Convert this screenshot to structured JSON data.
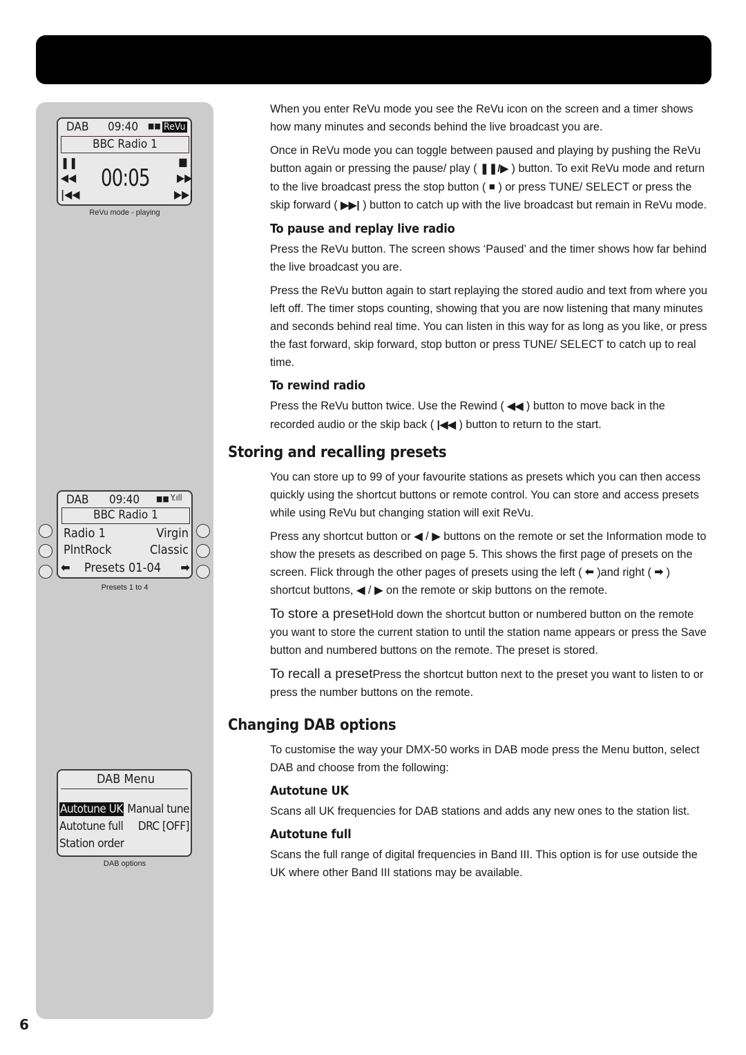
{
  "page": {
    "number": "6"
  },
  "screens": {
    "revu": {
      "mode": "DAB",
      "time": "09:40",
      "badge": "ReVu",
      "station": "BBC Radio 1",
      "timer": "00:05",
      "caption": "ReVu mode  - playing",
      "icons": [
        "pause-icon",
        "stop-icon",
        "rewind-icon",
        "fast-forward-icon",
        "skip-back-icon",
        "skip-forward-icon"
      ]
    },
    "presets": {
      "mode": "DAB",
      "time": "09:40",
      "station": "BBC Radio 1",
      "preset_1": "Radio 1",
      "preset_2": "Virgin",
      "preset_3": "PlntRock",
      "preset_4": "Classic",
      "page_label": "Presets 01-04",
      "caption": "Presets 1 to 4"
    },
    "menu": {
      "title": "DAB Menu",
      "items": [
        "Autotune UK",
        "Manual tune",
        "Autotune full",
        "DRC [OFF]",
        "Station order"
      ],
      "selected": "Autotune UK",
      "caption": "DAB options"
    }
  },
  "content": {
    "intro_1": "When you enter ReVu mode you see the ReVu icon on the screen and a timer shows how many minutes and seconds behind the live broadcast you are.",
    "intro_2a": "Once in ReVu mode you can toggle between paused and playing by pushing the ReVu button again or pressing the pause/ play (",
    "intro_2b": ") button. To exit ReVu mode and return to the live broadcast press the stop button (",
    "intro_2c": ") or press TUNE/ SELECT or press the skip forward (",
    "intro_2d": ") button to catch up with the live broadcast but remain in ReVu mode.",
    "pause_heading": "To pause and replay live radio",
    "pause_1": "Press the ReVu button. The screen shows ‘Paused’ and the timer shows how far behind the live broadcast you are.",
    "pause_2": "Press the ReVu button again to start replaying the stored audio and text from where you left off. The timer stops counting, showing that you are now listening that many minutes and seconds behind real time. You can listen in this way for as long as you like, or press the fast forward, skip forward, stop button or press TUNE/ SELECT to catch up to real time.",
    "rewind_heading": "To rewind radio",
    "rewind_a": "Press the ReVu button twice. Use the Rewind (",
    "rewind_b": ") button to move back in the recorded audio or the skip back (",
    "rewind_c": ") button to return to the start.",
    "presets_heading": "Storing and recalling presets",
    "presets_1": "You can store up to 99 of your favourite stations as presets which you can then access quickly using the shortcut buttons or remote control. You can store and access presets while using ReVu but changing station will exit ReVu.",
    "presets_2a": "Press any shortcut button or ◀ / ▶  buttons on the remote or set the Information mode to show the presets as described on page 5. This shows the first page of presets on the screen. Flick through the other pages of presets using the left (",
    "presets_2b": ")and right (",
    "presets_2c": ") shortcut buttons, ◀ / ▶ on the remote or skip buttons on the remote.",
    "store_lead": "To store a preset",
    "store_text": "Hold down the shortcut button or numbered button on the remote you want to store the current station to until the station name appears or press the Save button and numbered buttons on the remote. The preset is stored.",
    "recall_lead": "To recall a preset",
    "recall_text": "Press the shortcut button next to the preset you want to listen to or press the number buttons on the remote.",
    "dab_heading": "Changing DAB options",
    "dab_intro": "To customise the way your DMX-50 works in DAB mode press the Menu button, select DAB and choose from the following:",
    "autotune_uk_heading": "Autotune UK",
    "autotune_uk_text": "Scans all UK frequencies for DAB stations and adds any new ones to the station list.",
    "autotune_full_heading": "Autotune full",
    "autotune_full_text": "Scans the full range of digital frequencies in Band III. This option is for use outside the UK where other Band III stations may be available."
  }
}
